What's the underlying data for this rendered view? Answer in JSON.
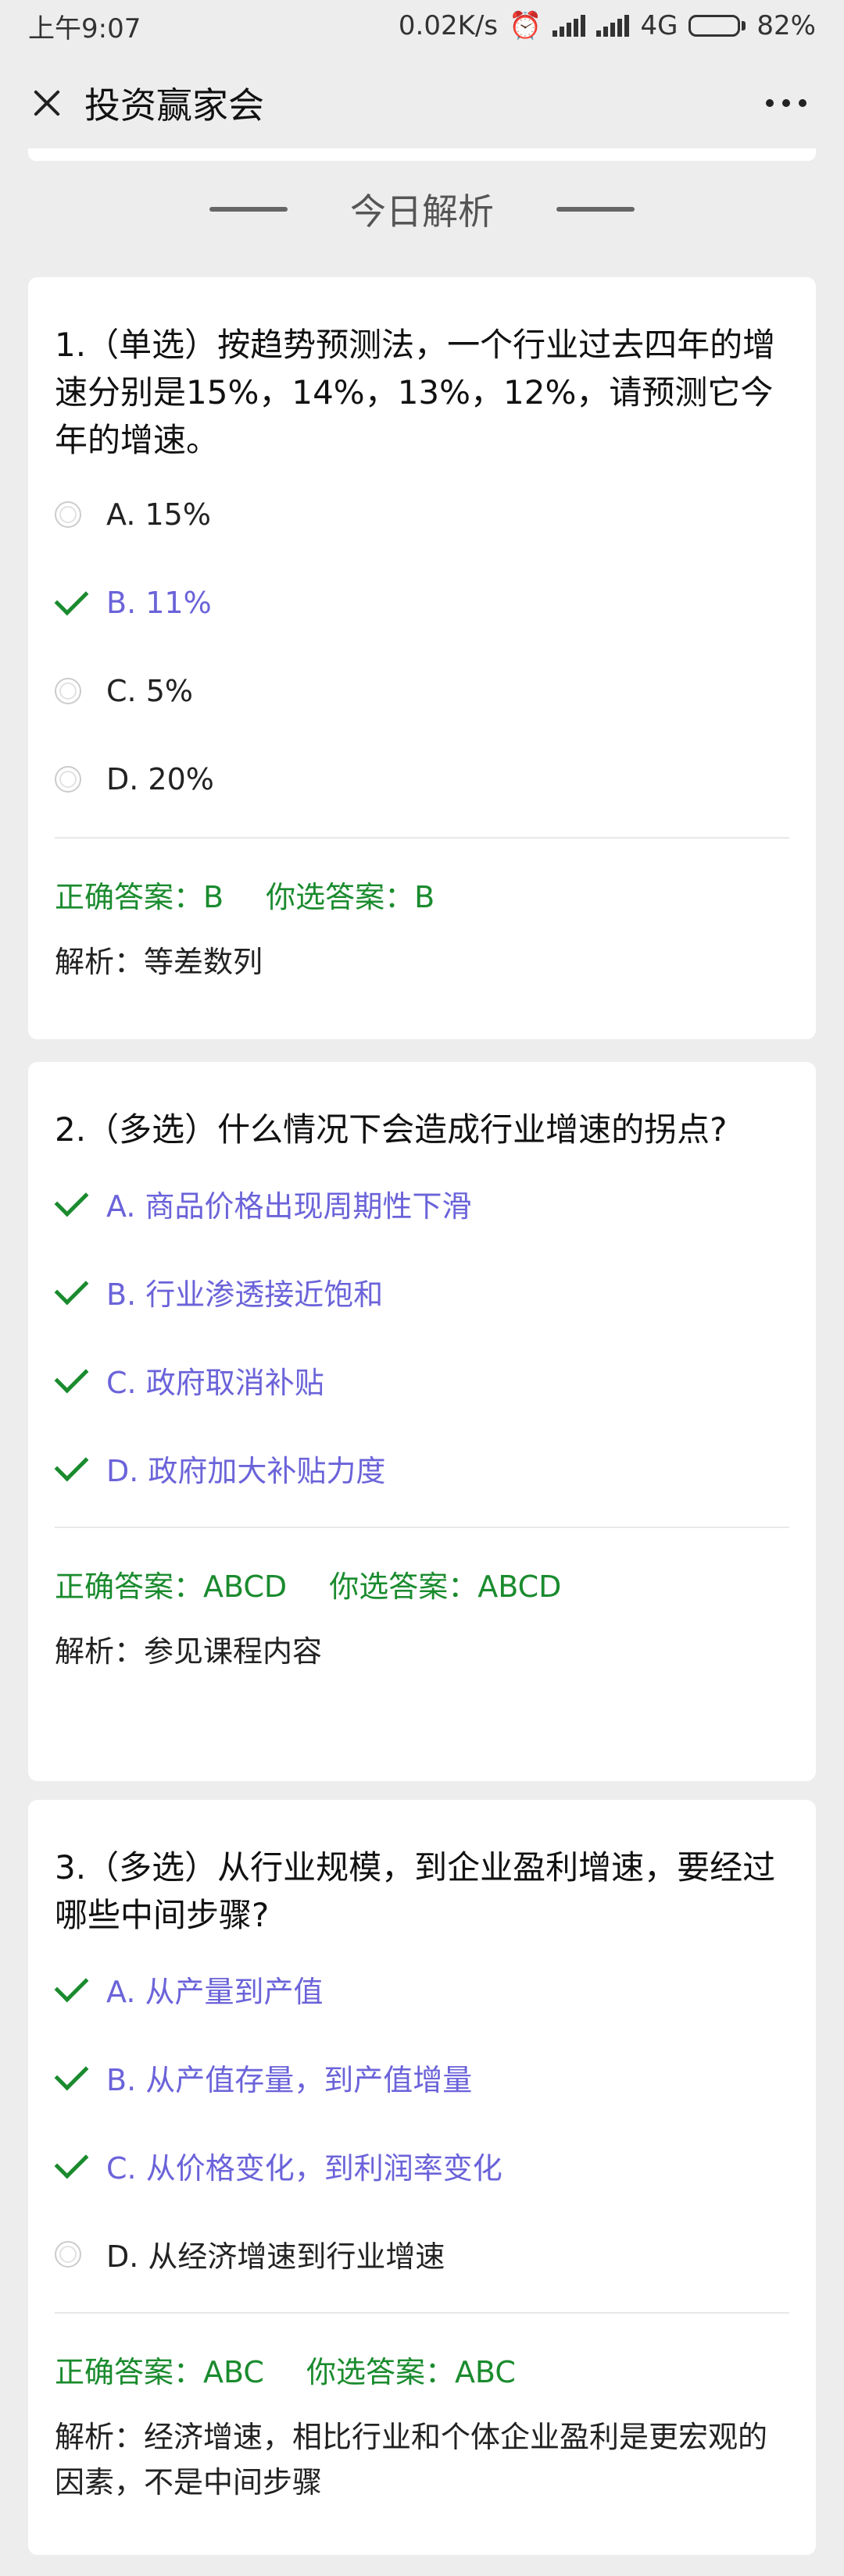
{
  "status": {
    "time": "上午9:07",
    "speed": "0.02K/s",
    "network": "4G",
    "battery": "82%",
    "battery_level": 0.82
  },
  "nav": {
    "title": "投资赢家会"
  },
  "section_title": "今日解析",
  "questions": [
    {
      "title": "1.（单选）按趋势预测法，一个行业过去四年的增速分别是15%，14%，13%，12%，请预测它今年的增速。",
      "options": [
        {
          "label": "A. 15%",
          "state": "unselected"
        },
        {
          "label": "B. 11%",
          "state": "selected"
        },
        {
          "label": "C. 5%",
          "state": "unselected"
        },
        {
          "label": "D. 20%",
          "state": "unselected"
        }
      ],
      "correct": "正确答案：B",
      "yours": "你选答案：B",
      "analysis": "解析：等差数列"
    },
    {
      "title": "2.（多选）什么情况下会造成行业增速的拐点?",
      "options": [
        {
          "label": "A. 商品价格出现周期性下滑",
          "state": "selected"
        },
        {
          "label": "B. 行业渗透接近饱和",
          "state": "selected"
        },
        {
          "label": "C. 政府取消补贴",
          "state": "selected"
        },
        {
          "label": "D. 政府加大补贴力度",
          "state": "selected"
        }
      ],
      "correct": "正确答案：ABCD",
      "yours": "你选答案：ABCD",
      "analysis": "解析：参见课程内容"
    },
    {
      "title": "3.（多选）从行业规模，到企业盈利增速，要经过哪些中间步骤?",
      "options": [
        {
          "label": "A. 从产量到产值",
          "state": "selected"
        },
        {
          "label": "B. 从产值存量，到产值增量",
          "state": "selected"
        },
        {
          "label": "C. 从价格变化，到利润率变化",
          "state": "selected"
        },
        {
          "label": "D. 从经济增速到行业增速",
          "state": "unselected"
        }
      ],
      "correct": "正确答案：ABC",
      "yours": "你选答案：ABC",
      "analysis": "解析：经济增速，相比行业和个体企业盈利是更宏观的因素，不是中间步骤"
    }
  ]
}
